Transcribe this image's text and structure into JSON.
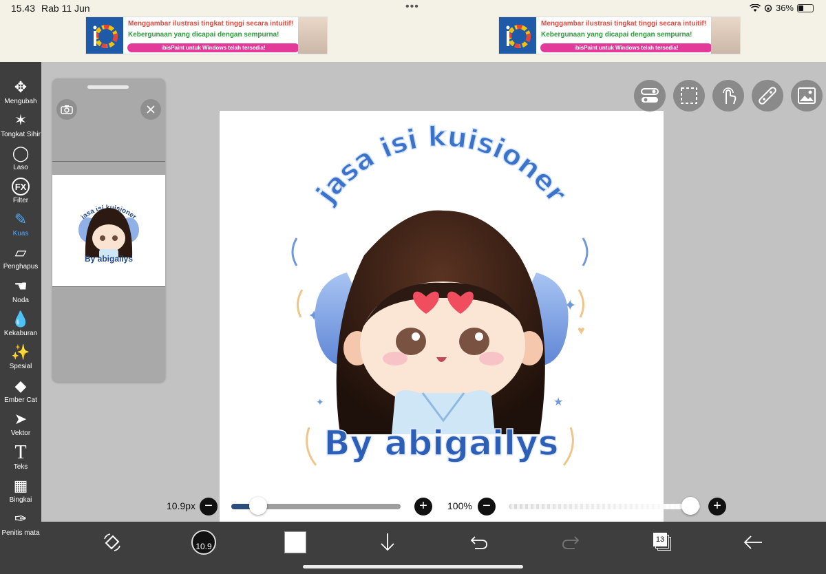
{
  "status": {
    "time": "15.43",
    "date": "Rab 11 Jun",
    "dots": "•••",
    "battery": "36%",
    "battery_level": 0.36
  },
  "ads": [
    {
      "line1": "Menggambar ilustrasi tingkat tinggi secara intuitif!",
      "line2": "Kebergunaan yang dicapai dengan sempurna!",
      "pill": "ibisPaint untuk Windows telah tersedia!"
    },
    {
      "line1": "Menggambar ilustrasi tingkat tinggi secara intuitif!",
      "line2": "Kebergunaan yang dicapai dengan sempurna!",
      "pill": "ibisPaint untuk Windows telah tersedia!"
    }
  ],
  "tools": [
    {
      "label": "Mengubah",
      "icon": "move-arrows-icon",
      "glyph": "✥"
    },
    {
      "label": "Tongkat Sihir",
      "icon": "magic-wand-icon",
      "glyph": "✶"
    },
    {
      "label": "Laso",
      "icon": "lasso-icon",
      "glyph": "◯"
    },
    {
      "label": "Filter",
      "icon": "fx-icon",
      "glyph": "FX"
    },
    {
      "label": "Kuas",
      "icon": "brush-icon",
      "glyph": "✎"
    },
    {
      "label": "Penghapus",
      "icon": "eraser-icon",
      "glyph": "▱"
    },
    {
      "label": "Noda",
      "icon": "smudge-icon",
      "glyph": "☚"
    },
    {
      "label": "Kekaburan",
      "icon": "blur-drop-icon",
      "glyph": "💧"
    },
    {
      "label": "Spesial",
      "icon": "special-sparkle-icon",
      "glyph": "✨"
    },
    {
      "label": "Ember Cat",
      "icon": "paint-bucket-icon",
      "glyph": "◆"
    },
    {
      "label": "Vektor",
      "icon": "vector-arrow-icon",
      "glyph": "➤"
    },
    {
      "label": "Teks",
      "icon": "text-icon",
      "glyph": "T"
    },
    {
      "label": "Bingkai",
      "icon": "frame-icon",
      "glyph": "▦"
    },
    {
      "label": "Penitis mata",
      "icon": "eyedropper-icon",
      "glyph": "✑"
    }
  ],
  "active_tool": "Kuas",
  "artwork": {
    "arc_text": "jasa isi kuisioner",
    "signature": "By abigailys"
  },
  "layer_thumb": {
    "arc_text": "jasa isi kuisioner",
    "signature": "By abigailys"
  },
  "brush": {
    "size_label": "10.9px",
    "size_fraction": 0.16,
    "opacity_label": "100%",
    "opacity_fraction": 1.0,
    "minus": "−",
    "plus": "+"
  },
  "bottom": {
    "brush_size_badge": "10.9",
    "layer_count": "13"
  },
  "colors": {
    "accent": "#4aa8ff",
    "slider_fill": "#2d4e79",
    "ad_pink": "#e33a9a",
    "ad_logo_bg": "#1e5aa8"
  }
}
